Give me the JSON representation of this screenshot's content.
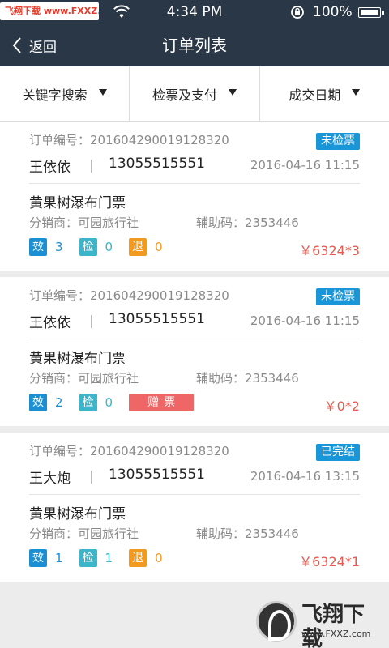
{
  "status_bar": {
    "watermark": "飞翔下载 www.FXXZ.com",
    "time": "4:34 PM",
    "battery": "100%",
    "icons": [
      "wifi-icon",
      "rotation-lock-icon",
      "battery-icon"
    ]
  },
  "nav": {
    "back_label": "返回",
    "title": "订单列表"
  },
  "filters": [
    {
      "label": "关键字搜索"
    },
    {
      "label": "检票及支付"
    },
    {
      "label": "成交日期"
    }
  ],
  "orders": [
    {
      "order_no": "订单编号：201604290019128320",
      "status": "未检票",
      "name": "王依依",
      "phone": "13055515551",
      "date": "2016-04-16 11:15",
      "product": "黄果树瀑布门票",
      "distributor": "分销商：可园旅行社",
      "aux_code": "辅助码：2353446",
      "eff_label": "效",
      "eff_count": "3",
      "chk_label": "检",
      "chk_count": "0",
      "ref_label": "退",
      "ref_count": "0",
      "price": "￥6324*3"
    },
    {
      "order_no": "订单编号：201604290019128320",
      "status": "未检票",
      "name": "王依依",
      "phone": "13055515551",
      "date": "2016-04-16 11:15",
      "product": "黄果树瀑布门票",
      "distributor": "分销商：可园旅行社",
      "aux_code": "辅助码：2353446",
      "eff_label": "效",
      "eff_count": "2",
      "chk_label": "检",
      "chk_count": "0",
      "gift_label": "赠票",
      "price": "￥0*2"
    },
    {
      "order_no": "订单编号：201604290019128320",
      "status": "已完结",
      "name": "王大炮",
      "phone": "13055515551",
      "date": "2016-04-16 13:15",
      "product": "黄果树瀑布门票",
      "distributor": "分销商：可园旅行社",
      "aux_code": "辅助码：2353446",
      "eff_label": "效",
      "eff_count": "1",
      "chk_label": "检",
      "chk_count": "1",
      "ref_label": "退",
      "ref_count": "0",
      "price": "￥6324*1"
    }
  ],
  "watermark_logo": {
    "text": "飞翔下载",
    "url": "www.FXXZ.com"
  },
  "colors": {
    "nav_bg": "#293746",
    "status_blue": "#1996d8",
    "price_red": "#e85a50",
    "eff_blue": "#1b8fd2",
    "chk_teal": "#3ab5c9",
    "ref_orange": "#f19a1f",
    "gift_red": "#ee6666"
  }
}
